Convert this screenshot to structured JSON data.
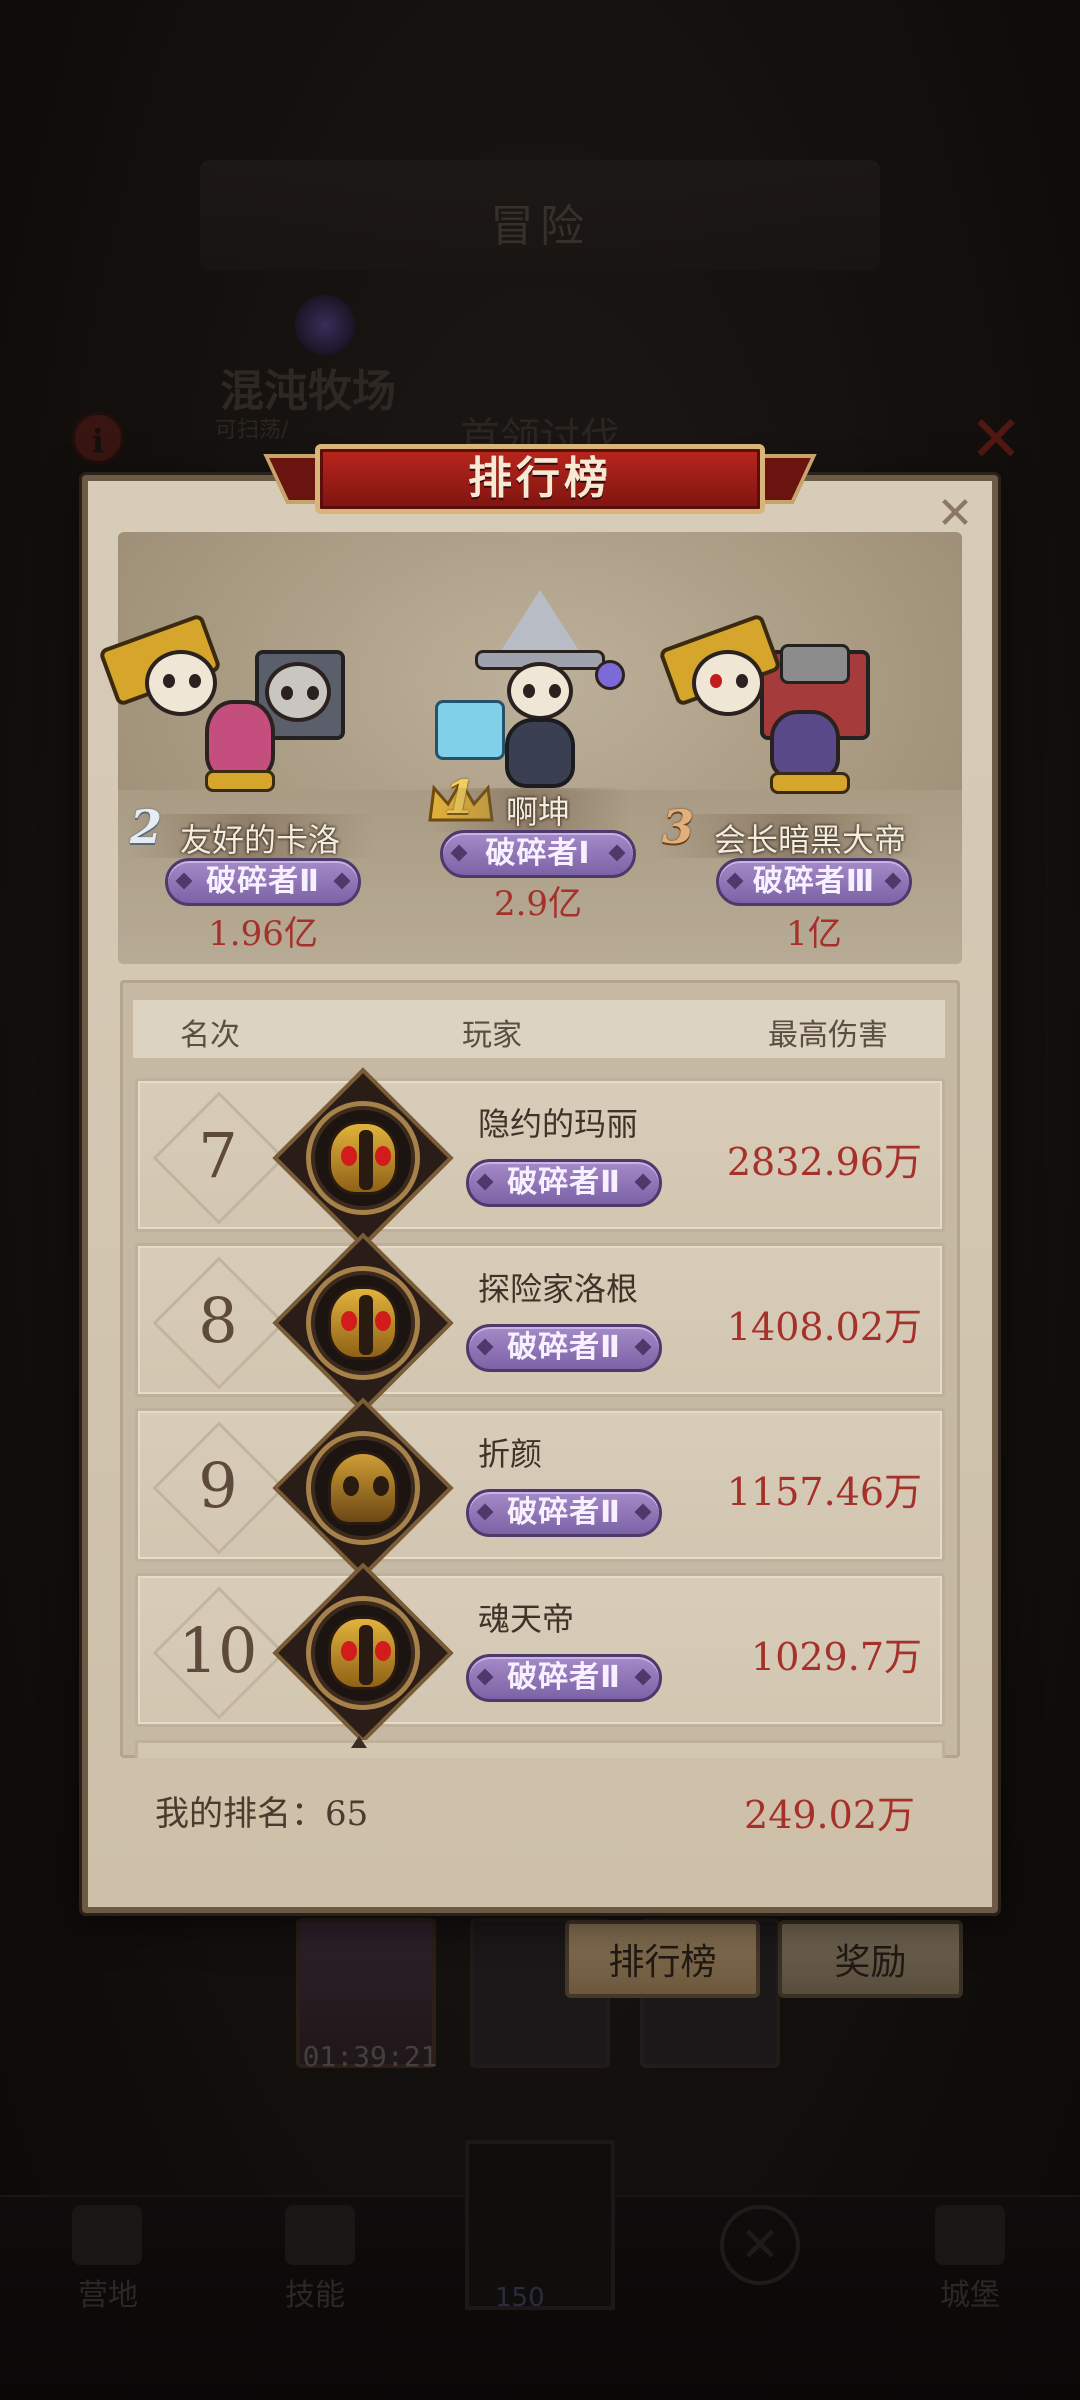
{
  "background": {
    "header_title": "冒险",
    "stage_name": "混沌牧场",
    "stage_subtitle": "可扫荡/",
    "boss_title": "首领讨伐",
    "tabs": {
      "leaderboard": "排行榜",
      "rewards": "奖励"
    },
    "card_timer": "01:39:21",
    "nav": {
      "left1": "营地",
      "left2": "技能",
      "right": "城堡",
      "center_count": "150"
    }
  },
  "modal": {
    "title": "排行榜",
    "top3": [
      {
        "rank": "1",
        "name": "啊坤",
        "title": "破碎者Ⅰ",
        "damage": "2.9亿"
      },
      {
        "rank": "2",
        "name": "友好的卡洛",
        "title": "破碎者Ⅱ",
        "damage": "1.96亿"
      },
      {
        "rank": "3",
        "name": "会长暗黑大帝",
        "title": "破碎者Ⅲ",
        "damage": "1亿"
      }
    ],
    "columns": {
      "rank": "名次",
      "player": "玩家",
      "damage": "最高伤害"
    },
    "rows": [
      {
        "rank": "7",
        "name": "隐约的玛丽",
        "title": "破碎者Ⅱ",
        "damage": "2832.96万",
        "avatar": "knight-avatar"
      },
      {
        "rank": "8",
        "name": "探险家洛根",
        "title": "破碎者Ⅱ",
        "damage": "1408.02万",
        "avatar": "knight-avatar"
      },
      {
        "rank": "9",
        "name": "折颜",
        "title": "破碎者Ⅱ",
        "damage": "1157.46万",
        "avatar": "bee-avatar"
      },
      {
        "rank": "10",
        "name": "魂天帝",
        "title": "破碎者Ⅱ",
        "damage": "1029.7万",
        "avatar": "knight-avatar"
      }
    ],
    "my_rank_label": "我的排名：",
    "my_rank": "65",
    "my_damage": "249.02万"
  },
  "colors": {
    "damage_red": "#a6302a",
    "badge_purple": "#8b72b5",
    "banner_red": "#9c1d15",
    "parchment": "#d3c7b2"
  }
}
